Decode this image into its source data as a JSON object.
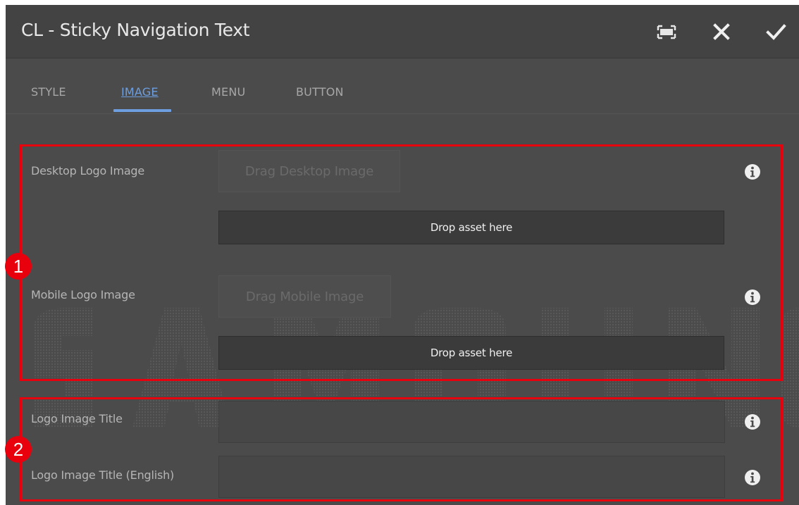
{
  "dialog": {
    "title": "CL - Sticky Navigation Text",
    "actions": {
      "fullscreen_icon": "fullscreen-icon",
      "close_icon": "close-icon",
      "confirm_icon": "checkmark-icon"
    }
  },
  "tabs": [
    {
      "label": "STYLE",
      "active": false
    },
    {
      "label": "IMAGE",
      "active": true
    },
    {
      "label": "MENU",
      "active": false
    },
    {
      "label": "BUTTON",
      "active": false
    }
  ],
  "image_section": {
    "desktop_logo": {
      "label": "Desktop Logo Image",
      "drag_label": "Drag Desktop Image",
      "drop_label": "Drop asset here"
    },
    "mobile_logo": {
      "label": "Mobile Logo Image",
      "drag_label": "Drag Mobile Image",
      "drop_label": "Drop asset here"
    }
  },
  "title_section": {
    "logo_title": {
      "label": "Logo Image Title",
      "value": ""
    },
    "logo_title_english": {
      "label": "Logo Image Title (English)",
      "value": ""
    }
  },
  "annotations": {
    "badge_1": "1",
    "badge_2": "2"
  },
  "colors": {
    "accent_tab": "#6d9fe0",
    "annotation_red": "#e8000d",
    "panel_bg": "#4b4b4b",
    "header_bg": "#434343"
  }
}
